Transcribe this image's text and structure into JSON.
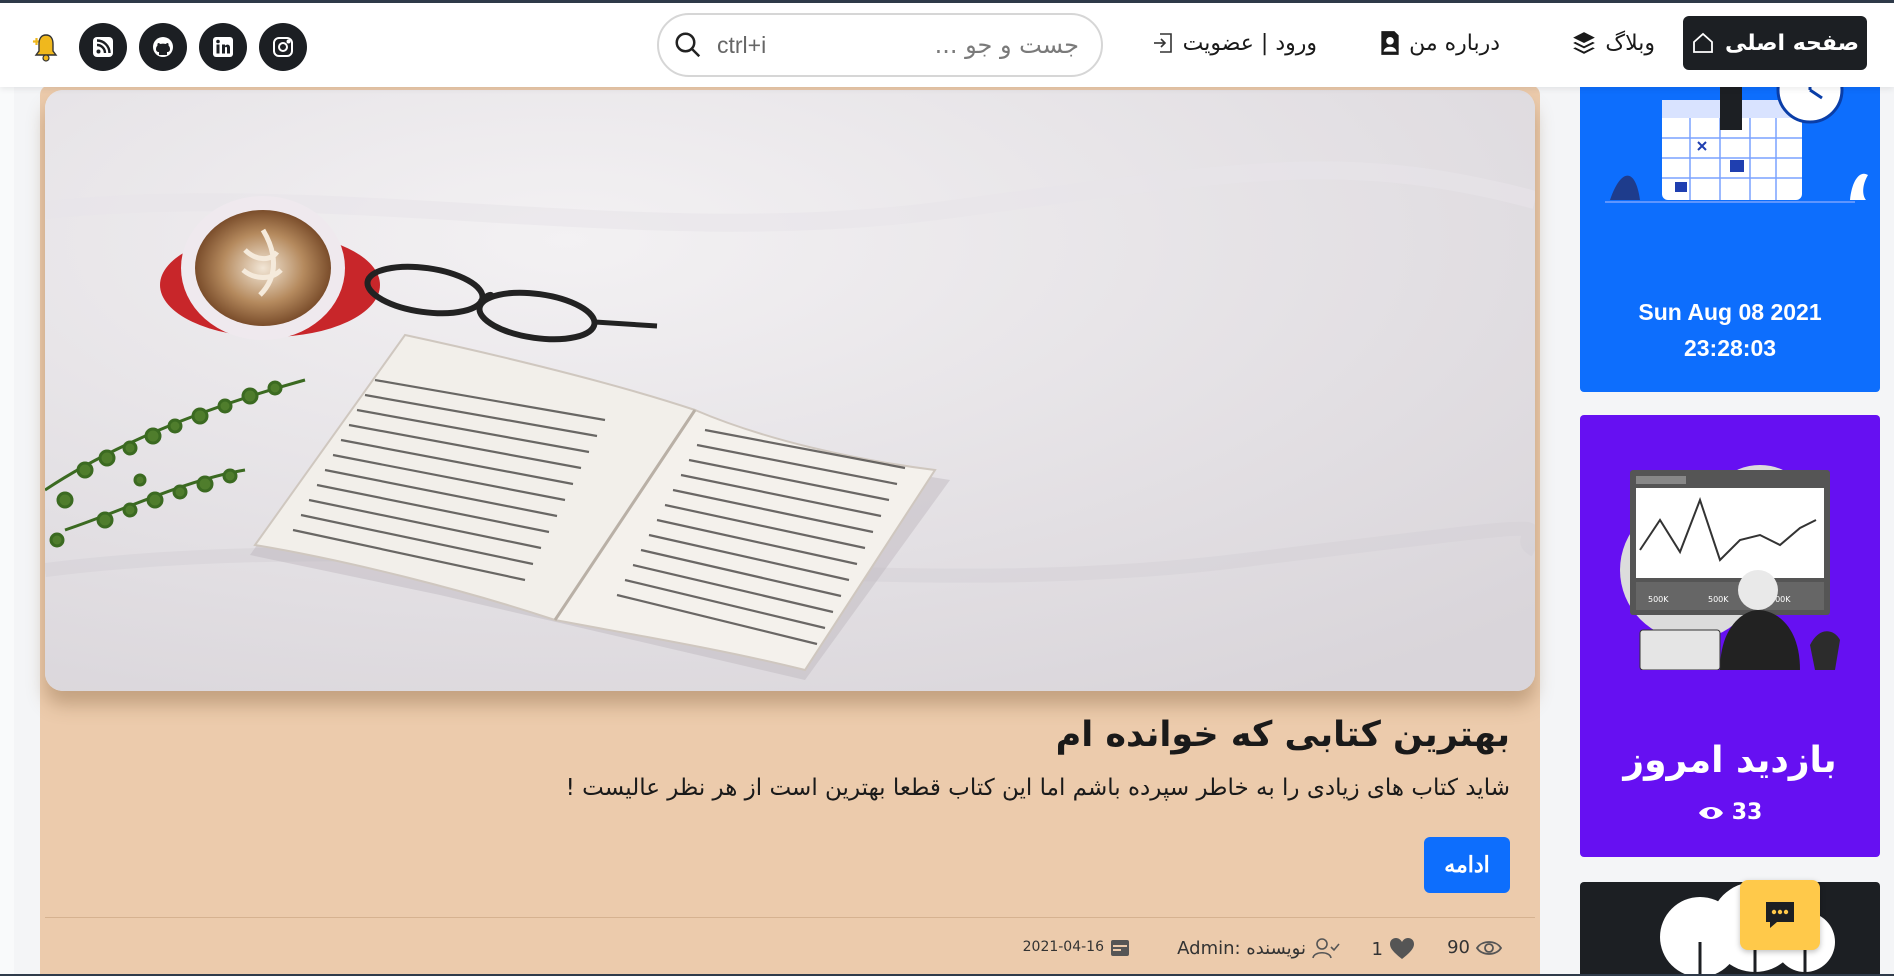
{
  "nav": {
    "home_label": "صفحه اصلی",
    "blog_label": "وبلاگ",
    "about_label": "درباره من",
    "login_label": "ورود | عضویت",
    "search_placeholder": "جست و جو ...",
    "search_shortcut": "ctrl+i",
    "social_icons": [
      "instagram-icon",
      "linkedin-icon",
      "github-icon",
      "rss-icon"
    ],
    "bell_icon": "bell-plus-icon"
  },
  "post": {
    "title": "بهترین کتابی که خوانده ام",
    "excerpt": "شاید کتاب های زیادی را به خاطر سپرده باشم اما این کتاب قطعا بهترین است از هر نظر عالیست !",
    "read_more_label": "ادامه",
    "views": "90",
    "likes": "1",
    "author": "نویسنده :Admin",
    "date": "2021-04-16",
    "card_color": "#eccbac"
  },
  "sidebar": {
    "clock_date": "Sun Aug 08 2021",
    "clock_time": "23:28:03",
    "visits_title": "بازدید امروز",
    "visits_count": "33",
    "blue_color": "#0d6efd",
    "purple_color": "#6610f2"
  },
  "chat": {
    "icon": "chat-icon",
    "color": "#ffc94a"
  }
}
